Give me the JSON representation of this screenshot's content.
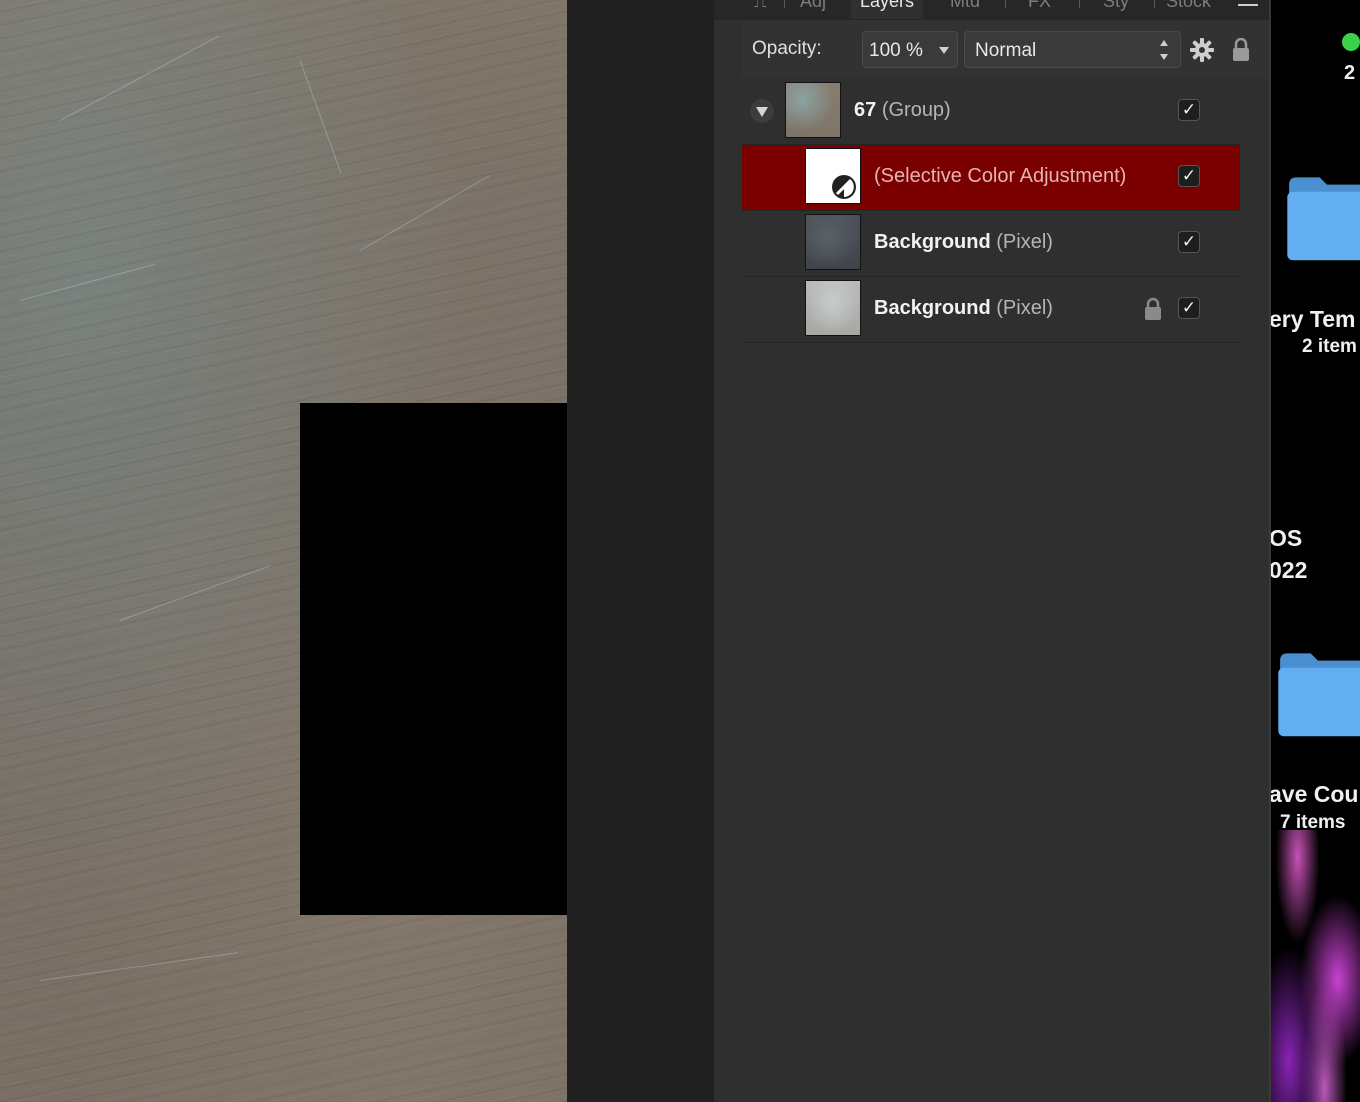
{
  "tabs": [
    "Adj",
    "Layers",
    "Mtd",
    "FX",
    "Sty",
    "Stock"
  ],
  "active_tab": "Layers",
  "toolbar": {
    "opacity_label": "Opacity:",
    "opacity_value": "100 %",
    "blend_mode": "Normal"
  },
  "layers": [
    {
      "name": "67",
      "type": "(Group)",
      "visible": true,
      "locked": false,
      "selected": false,
      "expanded": true
    },
    {
      "name": "",
      "type": "(Selective Color Adjustment)",
      "visible": true,
      "locked": false,
      "selected": true
    },
    {
      "name": "Background",
      "type": "(Pixel)",
      "visible": true,
      "locked": false,
      "selected": false
    },
    {
      "name": "Background",
      "type": "(Pixel)",
      "visible": true,
      "locked": true,
      "selected": false
    }
  ],
  "desktop": {
    "count": "2",
    "folders": [
      {
        "name": "ery Tem",
        "items": "2 item"
      },
      {
        "name": "OS",
        "subtitle": "022"
      },
      {
        "name": "ave Cou",
        "items": "7 items"
      }
    ]
  },
  "colors": {
    "selection": "#7a0000",
    "panel": "#2f2f2f",
    "status_dot": "#3bd24a",
    "folder": "#5fa8e6"
  }
}
